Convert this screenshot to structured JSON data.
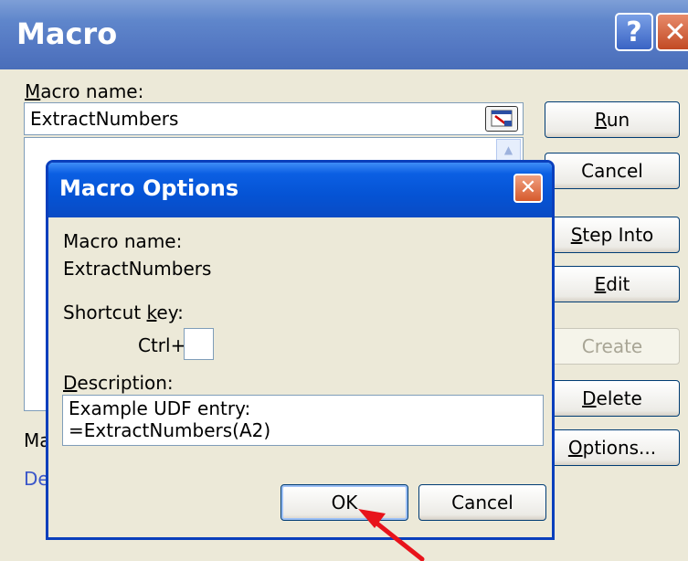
{
  "window": {
    "title": "Macro"
  },
  "macro_dialog": {
    "macro_name_label_pre": "",
    "macro_name_label_accel": "M",
    "macro_name_label_post": "acro name:",
    "macro_name_value": "ExtractNumbers",
    "macros_in_label_visible": "Ma",
    "description_label_visible": "Des",
    "buttons": {
      "run": {
        "pre": "",
        "accel": "R",
        "post": "un"
      },
      "cancel": "Cancel",
      "step_into": {
        "pre": "",
        "accel": "S",
        "post": "tep Into"
      },
      "edit": {
        "pre": "",
        "accel": "E",
        "post": "dit"
      },
      "create": "Create",
      "delete": {
        "pre": "",
        "accel": "D",
        "post": "elete"
      },
      "options": {
        "pre": "",
        "accel": "O",
        "post": "ptions..."
      }
    }
  },
  "options_dialog": {
    "title": "Macro Options",
    "macro_name_label": "Macro name:",
    "macro_name_value": "ExtractNumbers",
    "shortcut_label": {
      "pre": "Shortcut ",
      "accel": "k",
      "post": "ey:"
    },
    "ctrl_label": "Ctrl+",
    "shortcut_value": "",
    "description_label": {
      "pre": "",
      "accel": "D",
      "post": "escription:"
    },
    "description_value": "Example UDF entry:\n=ExtractNumbers(A2)",
    "ok_label": "OK",
    "cancel_label": "Cancel"
  },
  "colors": {
    "annotation_arrow": "#e8131b",
    "title_bar_inner": "#0553d4",
    "title_bar_outer": "#5377c2"
  },
  "icons": [
    "help-icon",
    "close-icon",
    "refedit-icon",
    "scroll-up-icon",
    "annotation-arrow-icon"
  ]
}
